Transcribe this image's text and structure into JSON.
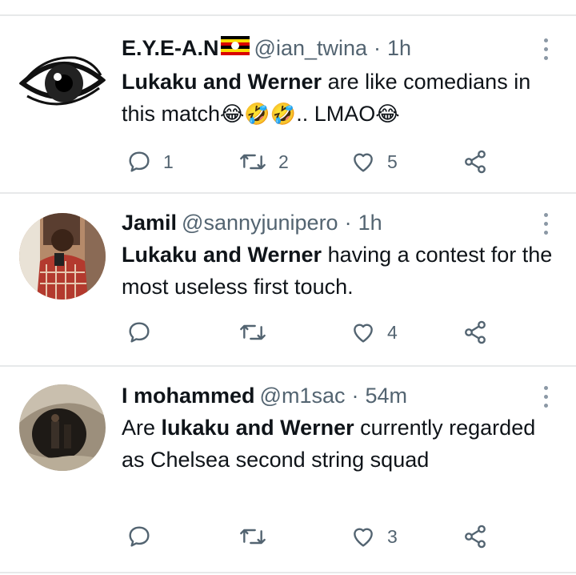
{
  "tweets": [
    {
      "name": "E.Y.E-A.N",
      "handle": "@ian_twina",
      "separator": "·",
      "time": "1h",
      "text_bold_1": "Lukaku and Werner",
      "text_rest_1": " are like comedians in this match",
      "emojis": "😂🤣🤣",
      "text_rest_2": ".. LMAO",
      "emoji_end": "😂",
      "reply_count": "1",
      "retweet_count": "2",
      "like_count": "5"
    },
    {
      "name": "Jamil",
      "handle": "@sannyjunipero",
      "separator": "·",
      "time": "1h",
      "text_bold_1": "Lukaku and Werner",
      "text_rest_1": " having a contest for the most useless first touch.",
      "reply_count": "",
      "retweet_count": "",
      "like_count": "4"
    },
    {
      "name": "I mohammed",
      "handle": "@m1sac",
      "separator": "·",
      "time": "54m",
      "text_pre": "Are ",
      "text_bold_1": "lukaku and Werner",
      "text_rest_1": " currently regarded as Chelsea second string squad",
      "reply_count": "",
      "retweet_count": "",
      "like_count": "3"
    }
  ],
  "icons": {
    "reply": "speech-bubble-icon",
    "retweet": "retweet-arrows-icon",
    "like": "heart-icon",
    "share": "share-nodes-icon",
    "more": "vertical-dots-icon",
    "flag": "uganda-flag-icon"
  },
  "colors": {
    "text": "#0f1419",
    "secondary": "#536471",
    "divider": "#e7e9ea",
    "icon": "#536471"
  }
}
